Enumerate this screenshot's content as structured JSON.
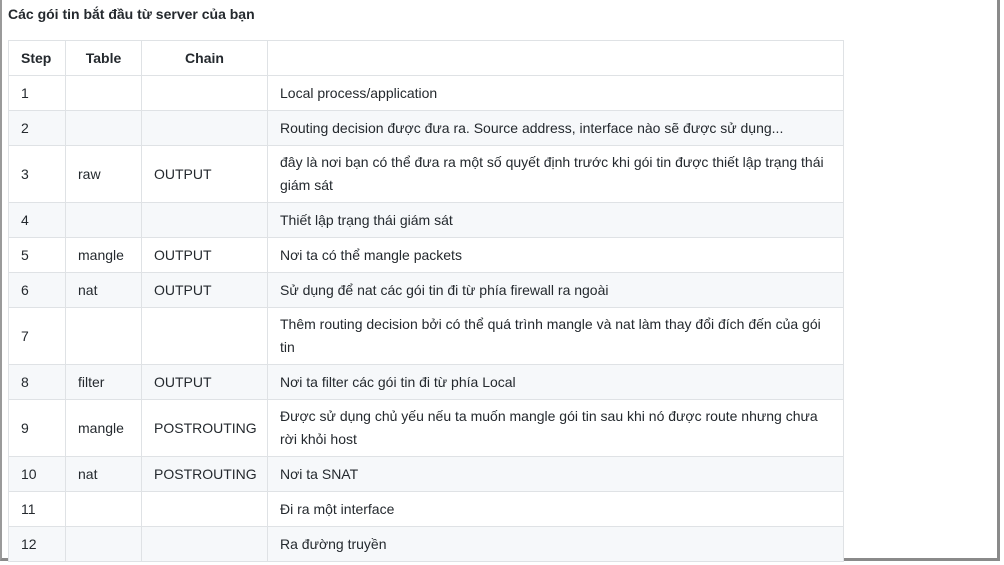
{
  "heading": "Các gói tin bắt đầu từ server của bạn",
  "columns": [
    "Step",
    "Table",
    "Chain",
    ""
  ],
  "rows": [
    {
      "step": "1",
      "table": "",
      "chain": "",
      "desc": "Local process/application"
    },
    {
      "step": "2",
      "table": "",
      "chain": "",
      "desc": "Routing decision được đưa ra. Source address, interface nào sẽ được sử dụng..."
    },
    {
      "step": "3",
      "table": "raw",
      "chain": "OUTPUT",
      "desc": "đây là nơi bạn có thể đưa ra một số quyết định trước khi gói tin được thiết lập trạng thái giám sát"
    },
    {
      "step": "4",
      "table": "",
      "chain": "",
      "desc": "Thiết lập trạng thái giám sát"
    },
    {
      "step": "5",
      "table": "mangle",
      "chain": "OUTPUT",
      "desc": "Nơi ta có thể mangle packets"
    },
    {
      "step": "6",
      "table": "nat",
      "chain": "OUTPUT",
      "desc": "Sử dụng để nat các gói tin đi từ phía firewall ra ngoài"
    },
    {
      "step": "7",
      "table": "",
      "chain": "",
      "desc": "Thêm routing decision bởi có thể quá trình mangle và nat làm thay đổi đích đến của gói tin"
    },
    {
      "step": "8",
      "table": "filter",
      "chain": "OUTPUT",
      "desc": "Nơi ta filter các gói tin đi từ phía Local"
    },
    {
      "step": "9",
      "table": "mangle",
      "chain": "POSTROUTING",
      "desc": "Được sử dụng chủ yếu nếu ta muốn mangle gói tin sau khi nó được route nhưng chưa rời khỏi host"
    },
    {
      "step": "10",
      "table": "nat",
      "chain": "POSTROUTING",
      "desc": "Nơi ta SNAT"
    },
    {
      "step": "11",
      "table": "",
      "chain": "",
      "desc": "Đi ra một interface"
    },
    {
      "step": "12",
      "table": "",
      "chain": "",
      "desc": "Ra đường truyền"
    }
  ]
}
